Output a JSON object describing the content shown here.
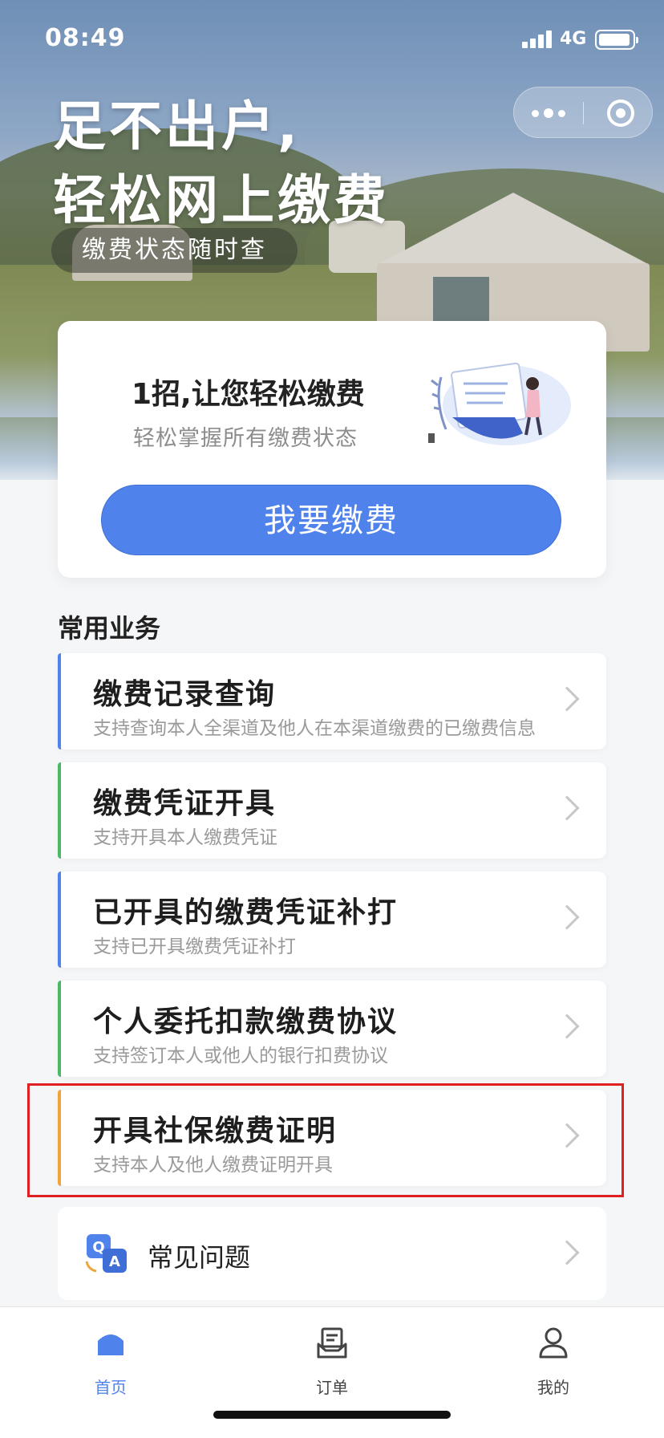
{
  "status_bar": {
    "time": "08:49",
    "network": "4G"
  },
  "hero": {
    "title_line1": "足不出户,",
    "title_line2": "轻松网上缴费",
    "tag": "缴费状态随时查"
  },
  "promo_card": {
    "title": "1招,让您轻松缴费",
    "subtitle": "轻松掌握所有缴费状态",
    "button": "我要缴费"
  },
  "services": {
    "section_title": "常用业务",
    "items": [
      {
        "title": "缴费记录查询",
        "desc": "支持查询本人全渠道及他人在本渠道缴费的已缴费信息",
        "accent": "#4f82eb"
      },
      {
        "title": "缴费凭证开具",
        "desc": "支持开具本人缴费凭证",
        "accent": "#4cb865"
      },
      {
        "title": "已开具的缴费凭证补打",
        "desc": "支持已开具缴费凭证补打",
        "accent": "#4f82eb"
      },
      {
        "title": "个人委托扣款缴费协议",
        "desc": "支持签订本人或他人的银行扣费协议",
        "accent": "#4cb865"
      },
      {
        "title": "开具社保缴费证明",
        "desc": "支持本人及他人缴费证明开具",
        "accent": "#f0a53a"
      }
    ]
  },
  "faq": {
    "label": "常见问题",
    "icon": "qa-icon"
  },
  "tabbar": {
    "items": [
      {
        "label": "首页",
        "icon": "home-icon",
        "active": true
      },
      {
        "label": "订单",
        "icon": "order-icon",
        "active": false
      },
      {
        "label": "我的",
        "icon": "user-icon",
        "active": false
      }
    ],
    "active_color": "#4f82eb"
  },
  "colors": {
    "primary": "#4f82eb",
    "highlight_border": "#e02020"
  }
}
